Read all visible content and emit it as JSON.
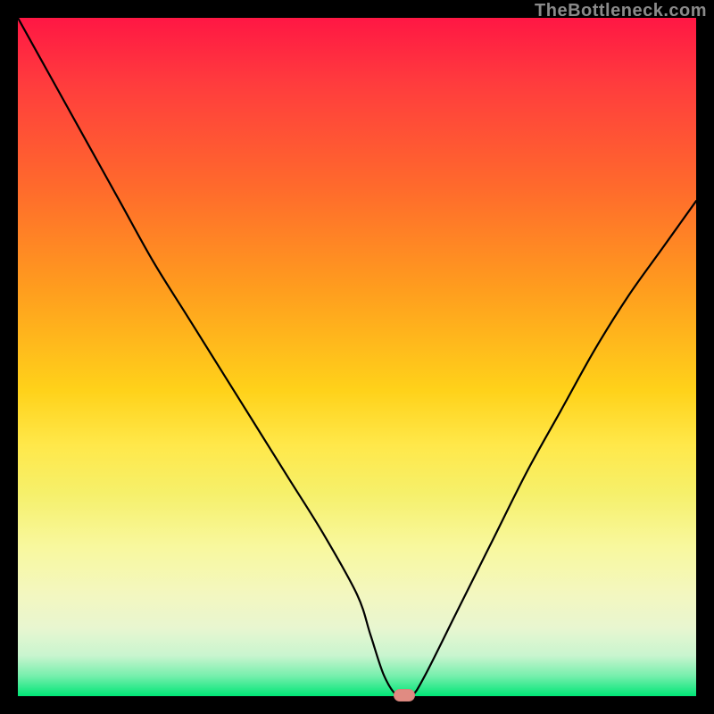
{
  "watermark": {
    "text": "TheBottleneck.com"
  },
  "chart_data": {
    "type": "line",
    "title": "",
    "xlabel": "",
    "ylabel": "",
    "xlim": [
      0,
      100
    ],
    "ylim": [
      0,
      100
    ],
    "grid": false,
    "series": [
      {
        "name": "bottleneck-curve",
        "x": [
          0,
          5,
          10,
          15,
          20,
          25,
          30,
          35,
          40,
          45,
          50,
          52,
          54,
          56,
          58,
          60,
          65,
          70,
          75,
          80,
          85,
          90,
          95,
          100
        ],
        "y": [
          100,
          91,
          82,
          73,
          64,
          56,
          48,
          40,
          32,
          24,
          15,
          9,
          3,
          0,
          0,
          3,
          13,
          23,
          33,
          42,
          51,
          59,
          66,
          73
        ]
      }
    ],
    "annotations": [
      {
        "name": "optimal-marker",
        "x": 57,
        "y": 0
      }
    ],
    "background_gradient": {
      "top": "#ff1744",
      "mid": "#ffd21a",
      "bottom": "#00e676"
    }
  },
  "marker": {
    "color": "#e08b82"
  }
}
